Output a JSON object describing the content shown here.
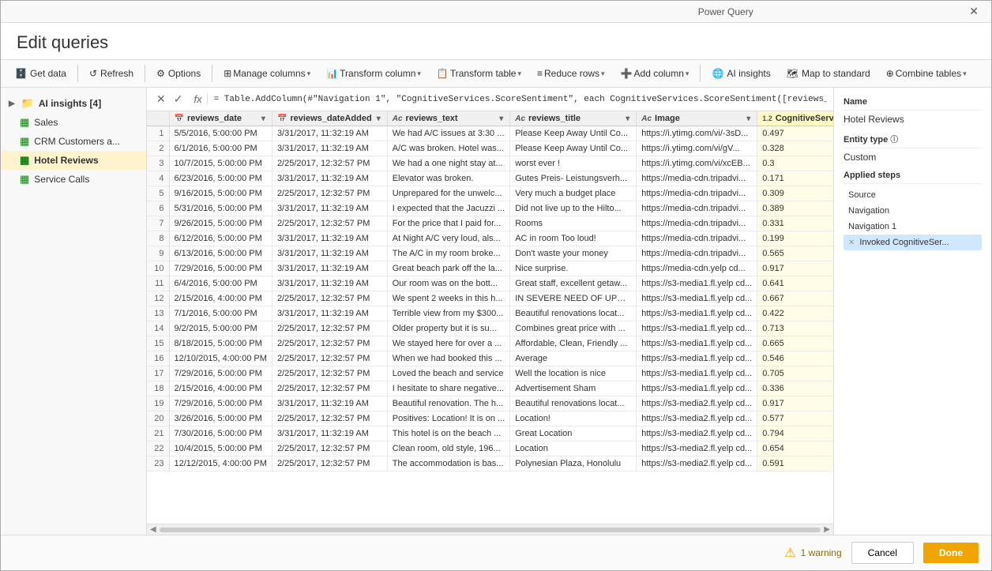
{
  "window": {
    "title": "Power Query",
    "close_label": "✕"
  },
  "page_header": "Edit queries",
  "toolbar": {
    "get_data": "Get data",
    "refresh": "Refresh",
    "options": "Options",
    "manage_columns": "Manage columns",
    "transform_column": "Transform column",
    "transform_table": "Transform table",
    "reduce_rows": "Reduce rows",
    "add_column": "Add column",
    "ai_insights": "AI insights",
    "map_to_standard": "Map to standard",
    "combine_tables": "Combine tables"
  },
  "sidebar": {
    "items": [
      {
        "label": "AI insights [4]",
        "type": "folder",
        "expanded": true
      },
      {
        "label": "Sales",
        "type": "table"
      },
      {
        "label": "CRM Customers a...",
        "type": "table"
      },
      {
        "label": "Hotel Reviews",
        "type": "table",
        "active": true
      },
      {
        "label": "Service Calls",
        "type": "table"
      }
    ]
  },
  "formula_bar": {
    "cancel": "✕",
    "confirm": "✓",
    "fx": "fx",
    "formula": "= Table.AddColumn(#\"Navigation 1\", \"CognitiveServices.ScoreSentiment\", each CognitiveServices.ScoreSentiment([reviews_text], \"en\"))"
  },
  "table": {
    "columns": [
      {
        "id": "reviews_date",
        "label": "reviews_date",
        "type": "date",
        "type_icon": "📅"
      },
      {
        "id": "reviews_dateAdded",
        "label": "reviews_dateAdded",
        "type": "date",
        "type_icon": "📅"
      },
      {
        "id": "reviews_text",
        "label": "reviews_text",
        "type": "text",
        "type_icon": "Ac"
      },
      {
        "id": "reviews_title",
        "label": "reviews_title",
        "type": "text",
        "type_icon": "Ac"
      },
      {
        "id": "Image",
        "label": "Image",
        "type": "text",
        "type_icon": "Ac"
      },
      {
        "id": "CognitiveServices",
        "label": "CognitiveServices....",
        "type": "num",
        "type_icon": "1.2",
        "highlighted": true
      }
    ],
    "rows": [
      [
        1,
        "5/5/2016, 5:00:00 PM",
        "3/31/2017, 11:32:19 AM",
        "We had A/C issues at 3:30 ...",
        "Please Keep Away Until Co...",
        "https://i.ytimg.com/vi/-3sD...",
        "0.497"
      ],
      [
        2,
        "6/1/2016, 5:00:00 PM",
        "3/31/2017, 11:32:19 AM",
        "A/C was broken. Hotel was...",
        "Please Keep Away Until Co...",
        "https://i.ytimg.com/vi/gV...",
        "0.328"
      ],
      [
        3,
        "10/7/2015, 5:00:00 PM",
        "2/25/2017, 12:32:57 PM",
        "We had a one night stay at...",
        "worst ever !",
        "https://i.ytimg.com/vi/xcEB...",
        "0.3"
      ],
      [
        4,
        "6/23/2016, 5:00:00 PM",
        "3/31/2017, 11:32:19 AM",
        "Elevator was broken.",
        "Gutes Preis- Leistungsverh...",
        "https://media-cdn.tripadvi...",
        "0.171"
      ],
      [
        5,
        "9/16/2015, 5:00:00 PM",
        "2/25/2017, 12:32:57 PM",
        "Unprepared for the unwelc...",
        "Very much a budget place",
        "https://media-cdn.tripadvi...",
        "0.309"
      ],
      [
        6,
        "5/31/2016, 5:00:00 PM",
        "3/31/2017, 11:32:19 AM",
        "I expected that the Jacuzzi ...",
        "Did not live up to the Hilto...",
        "https://media-cdn.tripadvi...",
        "0.389"
      ],
      [
        7,
        "9/26/2015, 5:00:00 PM",
        "2/25/2017, 12:32:57 PM",
        "For the price that I paid for...",
        "Rooms",
        "https://media-cdn.tripadvi...",
        "0.331"
      ],
      [
        8,
        "6/12/2016, 5:00:00 PM",
        "3/31/2017, 11:32:19 AM",
        "At Night A/C very loud, als...",
        "AC in room Too loud!",
        "https://media-cdn.tripadvi...",
        "0.199"
      ],
      [
        9,
        "6/13/2016, 5:00:00 PM",
        "3/31/2017, 11:32:19 AM",
        "The A/C in my room broke...",
        "Don't waste your money",
        "https://media-cdn.tripadvi...",
        "0.565"
      ],
      [
        10,
        "7/29/2016, 5:00:00 PM",
        "3/31/2017, 11:32:19 AM",
        "Great beach park off the la...",
        "Nice surprise.",
        "https://media-cdn.yelp cd...",
        "0.917"
      ],
      [
        11,
        "6/4/2016, 5:00:00 PM",
        "3/31/2017, 11:32:19 AM",
        "Our room was on the bott...",
        "Great staff, excellent getaw...",
        "https://s3-media1.fl.yelp cd...",
        "0.641"
      ],
      [
        12,
        "2/15/2016, 4:00:00 PM",
        "2/25/2017, 12:32:57 PM",
        "We spent 2 weeks in this h...",
        "IN SEVERE NEED OF UPDA...",
        "https://s3-media1.fl.yelp cd...",
        "0.667"
      ],
      [
        13,
        "7/1/2016, 5:00:00 PM",
        "3/31/2017, 11:32:19 AM",
        "Terrible view from my $300...",
        "Beautiful renovations locat...",
        "https://s3-media1.fl.yelp cd...",
        "0.422"
      ],
      [
        14,
        "9/2/2015, 5:00:00 PM",
        "2/25/2017, 12:32:57 PM",
        "Older property but it is su...",
        "Combines great price with ...",
        "https://s3-media1.fl.yelp cd...",
        "0.713"
      ],
      [
        15,
        "8/18/2015, 5:00:00 PM",
        "2/25/2017, 12:32:57 PM",
        "We stayed here for over a ...",
        "Affordable, Clean, Friendly ...",
        "https://s3-media1.fl.yelp cd...",
        "0.665"
      ],
      [
        16,
        "12/10/2015, 4:00:00 PM",
        "2/25/2017, 12:32:57 PM",
        "When we had booked this ...",
        "Average",
        "https://s3-media1.fl.yelp cd...",
        "0.546"
      ],
      [
        17,
        "7/29/2016, 5:00:00 PM",
        "2/25/2017, 12:32:57 PM",
        "Loved the beach and service",
        "Well the location is nice",
        "https://s3-media1.fl.yelp cd...",
        "0.705"
      ],
      [
        18,
        "2/15/2016, 4:00:00 PM",
        "2/25/2017, 12:32:57 PM",
        "I hesitate to share negative...",
        "Advertisement Sham",
        "https://s3-media1.fl.yelp cd...",
        "0.336"
      ],
      [
        19,
        "7/29/2016, 5:00:00 PM",
        "3/31/2017, 11:32:19 AM",
        "Beautiful renovation. The h...",
        "Beautiful renovations locat...",
        "https://s3-media2.fl.yelp cd...",
        "0.917"
      ],
      [
        20,
        "3/26/2016, 5:00:00 PM",
        "2/25/2017, 12:32:57 PM",
        "Positives: Location! It is on ...",
        "Location!",
        "https://s3-media2.fl.yelp cd...",
        "0.577"
      ],
      [
        21,
        "7/30/2016, 5:00:00 PM",
        "3/31/2017, 11:32:19 AM",
        "This hotel is on the beach ...",
        "Great Location",
        "https://s3-media2.fl.yelp cd...",
        "0.794"
      ],
      [
        22,
        "10/4/2015, 5:00:00 PM",
        "2/25/2017, 12:32:57 PM",
        "Clean room, old style, 196...",
        "Location",
        "https://s3-media2.fl.yelp cd...",
        "0.654"
      ],
      [
        23,
        "12/12/2015, 4:00:00 PM",
        "2/25/2017, 12:32:57 PM",
        "The accommodation is bas...",
        "Polynesian Plaza, Honolulu",
        "https://s3-media2.fl.yelp cd...",
        "0.591"
      ]
    ]
  },
  "properties": {
    "name_label": "Name",
    "name_value": "Hotel Reviews",
    "entity_type_label": "Entity type",
    "entity_type_info": "ⓘ",
    "entity_type_value": "Custom",
    "applied_steps_label": "Applied steps",
    "steps": [
      {
        "label": "Source",
        "deletable": false,
        "active": false
      },
      {
        "label": "Navigation",
        "deletable": false,
        "active": false
      },
      {
        "label": "Navigation 1",
        "deletable": false,
        "active": false
      },
      {
        "label": "Invoked CognitiveSer...",
        "deletable": true,
        "active": true
      }
    ]
  },
  "status_bar": {
    "warning_count": "1 warning",
    "cancel_label": "Cancel",
    "done_label": "Done"
  }
}
